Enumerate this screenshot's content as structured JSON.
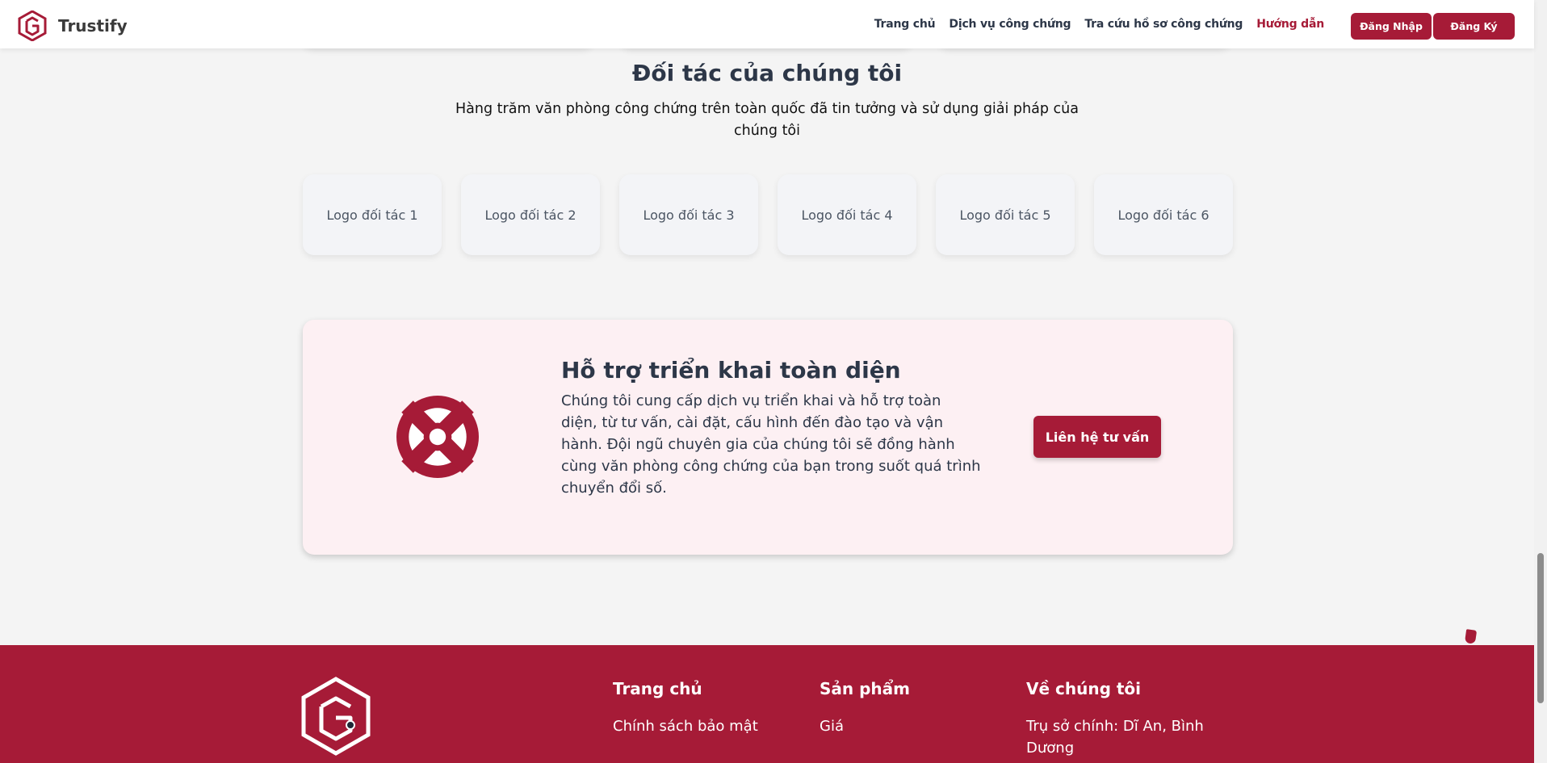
{
  "header": {
    "brand_name": "Trustify",
    "nav": [
      {
        "label": "Trang chủ"
      },
      {
        "label": "Dịch vụ công chứng"
      },
      {
        "label": "Tra cứu hồ sơ công chứng"
      },
      {
        "label": "Hướng dẫn"
      }
    ],
    "login_label": "Đăng Nhập",
    "register_label": "Đăng Ký"
  },
  "partners": {
    "title": "Đối tác của chúng tôi",
    "subtitle": "Hàng trăm văn phòng công chứng trên toàn quốc đã tin tưởng và sử dụng giải pháp của chúng tôi",
    "logos": [
      {
        "label": "Logo đối tác 1"
      },
      {
        "label": "Logo đối tác 2"
      },
      {
        "label": "Logo đối tác 3"
      },
      {
        "label": "Logo đối tác 4"
      },
      {
        "label": "Logo đối tác 5"
      },
      {
        "label": "Logo đối tác 6"
      }
    ]
  },
  "support": {
    "title": "Hỗ trợ triển khai toàn diện",
    "text": "Chúng tôi cung cấp dịch vụ triển khai và hỗ trợ toàn diện, từ tư vấn, cài đặt, cấu hình đến đào tạo và vận hành. Đội ngũ chuyên gia của chúng tôi sẽ đồng hành cùng văn phòng công chứng của bạn trong suốt quá trình chuyển đổi số.",
    "button_label": "Liên hệ tư vấn",
    "icon": "lifebuoy-icon"
  },
  "footer": {
    "columns": [
      {
        "title": "Trang chủ",
        "items": [
          "Chính sách bảo mật"
        ]
      },
      {
        "title": "Sản phẩm",
        "items": [
          "Giá"
        ]
      },
      {
        "title": "Về chúng tôi",
        "items": [
          "Trụ sở chính: Dĩ An, Bình Dương"
        ]
      }
    ]
  },
  "colors": {
    "brand": "#a61b37",
    "page_bg": "#f4f4f4",
    "support_bg": "#fdf0f3",
    "text_dark": "#2d3748"
  }
}
